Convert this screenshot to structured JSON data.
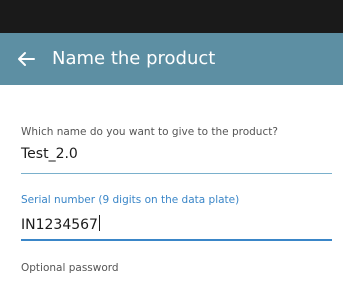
{
  "header": {
    "title": "Name the product"
  },
  "fields": [
    {
      "label": "Which name do you want to give to the product?",
      "value": "Test_2.0"
    },
    {
      "label": "Serial number (9 digits on the data plate)",
      "value": "IN1234567"
    },
    {
      "label": "Optional password"
    }
  ]
}
